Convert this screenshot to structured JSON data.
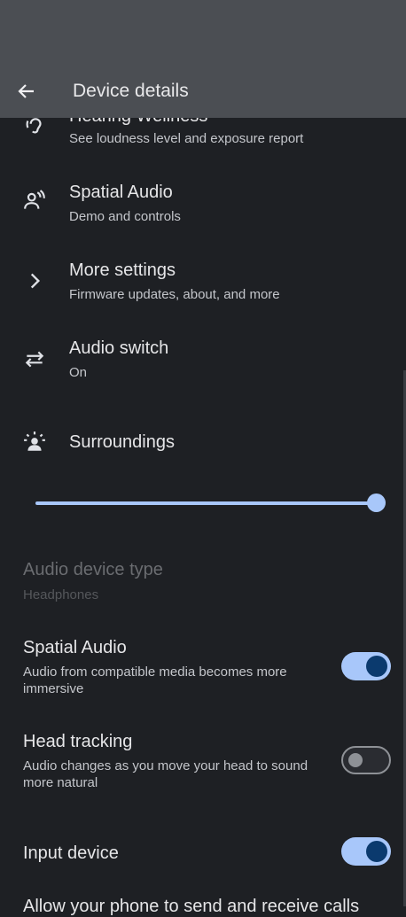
{
  "header": {
    "title": "Device details",
    "back_icon": "arrow-back-icon"
  },
  "list": [
    {
      "icon": "ear-icon",
      "title": "Hearing Wellness",
      "subtitle": "See loudness level and exposure report"
    },
    {
      "icon": "spatial-audio-icon",
      "title": "Spatial Audio",
      "subtitle": "Demo and controls"
    },
    {
      "icon": "chevron-right-icon",
      "title": "More settings",
      "subtitle": "Firmware updates, about, and more"
    },
    {
      "icon": "swap-arrows-icon",
      "title": "Audio switch",
      "subtitle": "On"
    },
    {
      "icon": "surroundings-icon",
      "title": "Surroundings"
    }
  ],
  "surroundings_level": 1.0,
  "prefs": {
    "device_type": {
      "title": "Audio device type",
      "value": "Headphones"
    },
    "spatial_audio": {
      "title": "Spatial Audio",
      "subtitle": "Audio from compatible media becomes more immersive",
      "on": true
    },
    "head_tracking": {
      "title": "Head tracking",
      "subtitle": "Audio changes as you move your head to sound more natural",
      "on": false
    },
    "input_device": {
      "title": "Input device",
      "on": true
    }
  },
  "truncated_line": "Allow your phone to send and receive calls"
}
